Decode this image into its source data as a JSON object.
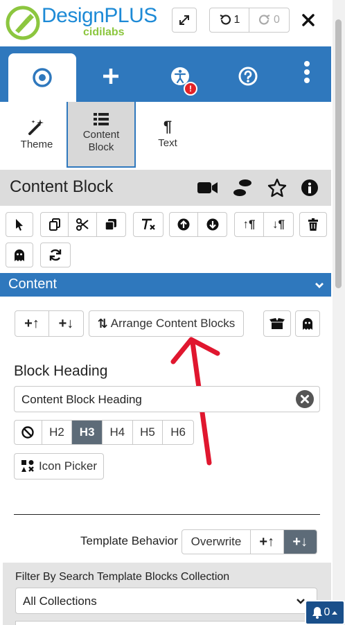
{
  "header": {
    "brand": "DesignPLUS",
    "brand_sub": "cidilabs",
    "undo_count": "1",
    "redo_count": "0"
  },
  "colors": {
    "primary": "#2f78bd",
    "brand_green": "#8cc63f",
    "brand_blue": "#1d8ad6",
    "alert": "#e32227",
    "active_seg": "#5d6b78"
  },
  "tabs": {
    "items": [
      {
        "icon": "target-icon"
      },
      {
        "icon": "plus-icon"
      },
      {
        "icon": "accessibility-icon",
        "badge": "!"
      },
      {
        "icon": "help-icon"
      },
      {
        "icon": "kebab-menu-icon"
      }
    ]
  },
  "subtabs": {
    "theme": "Theme",
    "content_block_line1": "Content",
    "content_block_line2": "Block",
    "text": "Text"
  },
  "section": {
    "title": "Content Block"
  },
  "accordion": {
    "title": "Content"
  },
  "content": {
    "arrange_label": "Arrange Content Blocks",
    "block_heading_label": "Block Heading",
    "block_heading_value": "Content Block Heading",
    "heading_levels": [
      "H2",
      "H3",
      "H4",
      "H5",
      "H6"
    ],
    "active_heading": "H3",
    "icon_picker_label": "Icon Picker"
  },
  "template": {
    "behavior_label": "Template Behavior",
    "overwrite_label": "Overwrite",
    "filter_label": "Filter By Search Template Blocks Collection",
    "collection_value": "All Collections"
  },
  "notifications": {
    "count": "0"
  }
}
